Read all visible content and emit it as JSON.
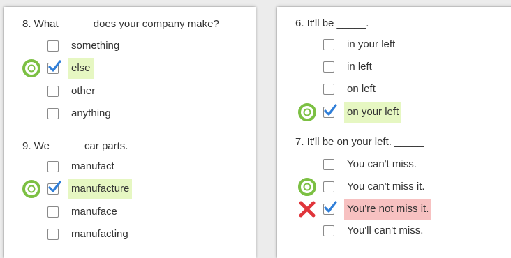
{
  "colors": {
    "correct_highlight": "#e6f7c2",
    "wrong_highlight": "#f7c1c1",
    "correct_marker": "#7cc043",
    "wrong_marker": "#e0353b",
    "check_blue": "#2f7ed8"
  },
  "left_panel": {
    "q8": {
      "question": "8. What _____ does your company make?",
      "options": [
        {
          "label": "something",
          "checked": false
        },
        {
          "label": "else",
          "checked": true,
          "marker": "correct-ring-icon"
        },
        {
          "label": "other",
          "checked": false
        },
        {
          "label": "anything",
          "checked": false
        }
      ]
    },
    "q9": {
      "question": "9. We _____ car parts.",
      "options": [
        {
          "label": "manufact",
          "checked": false
        },
        {
          "label": "manufacture",
          "checked": true,
          "marker": "correct-ring-icon"
        },
        {
          "label": "manuface",
          "checked": false
        },
        {
          "label": "manufacting",
          "checked": false
        }
      ]
    }
  },
  "right_panel": {
    "q6": {
      "question": "6. It'll be _____.",
      "options": [
        {
          "label": "in your left",
          "checked": false
        },
        {
          "label": "in left",
          "checked": false
        },
        {
          "label": "on left",
          "checked": false
        },
        {
          "label": "on your left",
          "checked": true,
          "marker": "correct-ring-icon"
        }
      ]
    },
    "q7": {
      "question": "7. It'll be on your left. _____",
      "options": [
        {
          "label": "You can't miss.",
          "checked": false
        },
        {
          "label": "You can't miss it.",
          "checked": false,
          "marker": "correct-ring-icon"
        },
        {
          "label": "You're not miss it.",
          "checked": true,
          "marker": "wrong-x-icon"
        },
        {
          "label": "You'll can't miss.",
          "checked": false
        }
      ]
    }
  }
}
